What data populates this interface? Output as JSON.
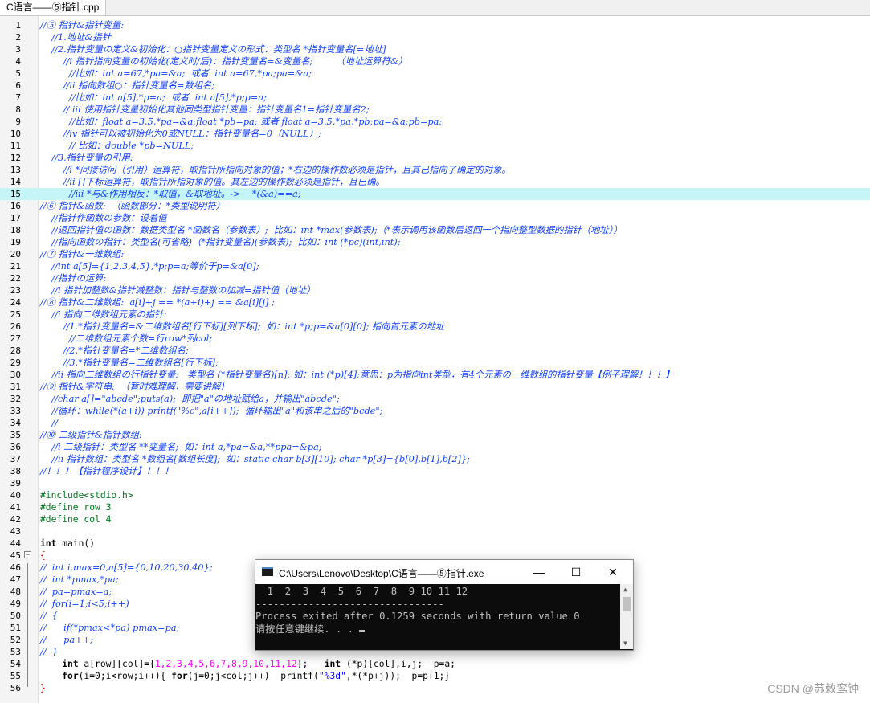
{
  "editor": {
    "tab_title": "C语言——⑤指针.cpp",
    "lines": [
      {
        "n": "1",
        "parts": [
          [
            "comment",
            "//⑤ 指针&指针变量:"
          ]
        ]
      },
      {
        "n": "2",
        "parts": [
          [
            "comment",
            "    //1.地址&指针"
          ]
        ]
      },
      {
        "n": "3",
        "parts": [
          [
            "comment",
            "    //2.指针变量の定义&初始化：○指针变量定义の形式：类型名 *指针变量名[=地址]"
          ]
        ]
      },
      {
        "n": "4",
        "parts": [
          [
            "comment",
            "        //ⅰ 指针指向变量の初始化(定义时/后)：指针变量名=&变量名;        （地址运算符&）"
          ]
        ]
      },
      {
        "n": "5",
        "parts": [
          [
            "comment",
            "          //比如：int a=67,*pa=&a;  或者  int a=67,*pa;pa=&a;"
          ]
        ]
      },
      {
        "n": "6",
        "parts": [
          [
            "comment",
            "        //ⅱ 指向数组○：指针变量名=数组名;"
          ]
        ]
      },
      {
        "n": "7",
        "parts": [
          [
            "comment",
            "          //比如：int a[5],*p=a;  或者  int a[5],*p;p=a;"
          ]
        ]
      },
      {
        "n": "8",
        "parts": [
          [
            "comment",
            "        // ⅲ 使用指针变量初始化其他同类型指针变量：指针变量名1=指针变量名2;"
          ]
        ]
      },
      {
        "n": "9",
        "parts": [
          [
            "comment",
            "          //比如：float a=3.5,*pa=&a;float *pb=pa; 或者 float a=3.5,*pa,*pb;pa=&a;pb=pa;"
          ]
        ]
      },
      {
        "n": "10",
        "parts": [
          [
            "comment",
            "        //ⅳ 指针可以被初始化为0或NULL：指针变量名=0（NULL）;"
          ]
        ]
      },
      {
        "n": "11",
        "parts": [
          [
            "comment",
            "          // 比如：double *pb=NULL;"
          ]
        ]
      },
      {
        "n": "12",
        "parts": [
          [
            "comment",
            "    //3.指针变量の引用:"
          ]
        ]
      },
      {
        "n": "13",
        "parts": [
          [
            "comment",
            "        //ⅰ *间接访问（引用）运算符，取指针所指向对象的值；*右边的操作数必须是指针，且其已指向了确定的对象。"
          ]
        ]
      },
      {
        "n": "14",
        "parts": [
          [
            "comment",
            "        //ⅱ []下标运算符，取指针所指对象的值。其左边的操作数必须是指针，且已确。"
          ]
        ]
      },
      {
        "n": "15",
        "hl": true,
        "parts": [
          [
            "comment",
            "          //ⅲ *与&作用相反：*取值，&取地址。->    *(&a)==a;"
          ]
        ]
      },
      {
        "n": "16",
        "parts": [
          [
            "comment",
            "//⑥ 指针&函数:  （函数部分：*类型说明符）"
          ]
        ]
      },
      {
        "n": "17",
        "parts": [
          [
            "comment",
            "    //指针作函数の参数：设着值"
          ]
        ]
      },
      {
        "n": "18",
        "parts": [
          [
            "comment",
            "    //返回指针值の函数：数据类型名 *函数名（参数表）;  比如：int *max(参数表);（*表示调用该函数后返回一个指向整型数据的指针（地址））"
          ]
        ]
      },
      {
        "n": "19",
        "parts": [
          [
            "comment",
            "    //指向函数の指针：类型名(可省略)（*指针变量名)(参数表);  比如：int (*pc)(int,int);"
          ]
        ]
      },
      {
        "n": "20",
        "parts": [
          [
            "comment",
            "//⑦ 指针&一维数组:"
          ]
        ]
      },
      {
        "n": "21",
        "parts": [
          [
            "comment",
            "    //int a[5]={1,2,3,4,5},*p;p=a;等价于p=&a[0];"
          ]
        ]
      },
      {
        "n": "22",
        "parts": [
          [
            "comment",
            "    //指针の运算:"
          ]
        ]
      },
      {
        "n": "23",
        "parts": [
          [
            "comment",
            "    //ⅰ 指针加整数&指针减整数：指针与整数の加减=指针值（地址）"
          ]
        ]
      },
      {
        "n": "24",
        "parts": [
          [
            "comment",
            "//⑧ 指针&二维数组:  a[i]+j == *(a+i)+j == &a[i][j] ;"
          ]
        ]
      },
      {
        "n": "25",
        "parts": [
          [
            "comment",
            "    //ⅰ 指向二维数组元素の指针:"
          ]
        ]
      },
      {
        "n": "26",
        "parts": [
          [
            "comment",
            "        //1.*指针变量名=&二维数组名[行下标][列下标];  如：int *p;p=&a[0][0]; 指向首元素の地址"
          ]
        ]
      },
      {
        "n": "27",
        "parts": [
          [
            "comment",
            "          //二维数组元素个数=行row*列col;"
          ]
        ]
      },
      {
        "n": "28",
        "parts": [
          [
            "comment",
            "        //2.*指针变量名=*二维数组名;"
          ]
        ]
      },
      {
        "n": "29",
        "parts": [
          [
            "comment",
            "        //3.*指针变量名=二维数组名[行下标];"
          ]
        ]
      },
      {
        "n": "30",
        "parts": [
          [
            "comment",
            "    //ⅱ 指向二维数组の行指针变量:   类型名 (*指针变量名)[n]; 如：int (*p)[4];意思：p为指向int类型，有4个元素の一维数组的指针变量【例子理解！！！】"
          ]
        ]
      },
      {
        "n": "31",
        "parts": [
          [
            "comment",
            "//⑨ 指针&字符串:  （暂时难理解，需要讲解）"
          ]
        ]
      },
      {
        "n": "32",
        "parts": [
          [
            "comment",
            "    //char a[]=\"abcde\";puts(a);  即把\"a\"の地址赋给a，并输出\"abcde\";"
          ]
        ]
      },
      {
        "n": "33",
        "parts": [
          [
            "comment",
            "    //循环：while(*(a+i)) printf(\"%c\",a[i++]);  循环输出\"a\"和该串之后的\"bcde\";"
          ]
        ]
      },
      {
        "n": "34",
        "parts": [
          [
            "comment",
            "    //"
          ]
        ]
      },
      {
        "n": "35",
        "parts": [
          [
            "comment",
            "//⑩ 二级指针&指针数组:"
          ]
        ]
      },
      {
        "n": "36",
        "parts": [
          [
            "comment",
            "    //ⅰ 二级指针：类型名 **变量名;  如：int a,*pa=&a,**ppa=&pa;"
          ]
        ]
      },
      {
        "n": "37",
        "parts": [
          [
            "comment",
            "    //ⅱ 指针数组：类型名 *数组名[数组长度];  如：static char b[3][10]; char *p[3]={b[0],b[1],b[2]};"
          ]
        ]
      },
      {
        "n": "38",
        "parts": [
          [
            "comment",
            "//！！！【指针程序设计】！！！"
          ]
        ]
      },
      {
        "n": "39",
        "parts": []
      },
      {
        "n": "40",
        "parts": [
          [
            "pre",
            "#include<stdio.h>"
          ]
        ]
      },
      {
        "n": "41",
        "parts": [
          [
            "pre",
            "#define row 3"
          ]
        ]
      },
      {
        "n": "42",
        "parts": [
          [
            "pre",
            "#define col 4"
          ]
        ]
      },
      {
        "n": "43",
        "parts": []
      },
      {
        "n": "44",
        "parts": [
          [
            "kw",
            "int"
          ],
          [
            "plain",
            " main()"
          ]
        ]
      },
      {
        "n": "45",
        "fold": true,
        "parts": [
          [
            "brace",
            "{"
          ]
        ]
      },
      {
        "n": "46",
        "parts": [
          [
            "comment",
            "//  int i,max=0,a[5]={0,10,20,30,40};"
          ]
        ]
      },
      {
        "n": "47",
        "parts": [
          [
            "comment",
            "//  int *pmax,*pa;"
          ]
        ]
      },
      {
        "n": "48",
        "parts": [
          [
            "comment",
            "//  pa=pmax=a;"
          ]
        ]
      },
      {
        "n": "49",
        "parts": [
          [
            "comment",
            "//  for(i=1;i<5;i++)"
          ]
        ]
      },
      {
        "n": "50",
        "parts": [
          [
            "comment",
            "//  {"
          ]
        ]
      },
      {
        "n": "51",
        "parts": [
          [
            "comment",
            "//      if(*pmax<*pa) pmax=pa;"
          ]
        ]
      },
      {
        "n": "52",
        "parts": [
          [
            "comment",
            "//      pa++;"
          ]
        ]
      },
      {
        "n": "53",
        "parts": [
          [
            "comment",
            "//  }"
          ]
        ]
      },
      {
        "n": "54",
        "parts": [
          [
            "plain",
            "    "
          ],
          [
            "kw",
            "int"
          ],
          [
            "plain",
            " a[row][col]={"
          ],
          [
            "num",
            "1,2,3,4,5,6,7,8,9,10,11,12"
          ],
          [
            "plain",
            "};   "
          ],
          [
            "kw",
            "int"
          ],
          [
            "plain",
            " (*p)[col],i,j;  p=a;"
          ]
        ]
      },
      {
        "n": "55",
        "parts": [
          [
            "plain",
            "    "
          ],
          [
            "kw",
            "for"
          ],
          [
            "plain",
            "(i=0;i<row;i++){ "
          ],
          [
            "kw",
            "for"
          ],
          [
            "plain",
            "(j=0;j<col;j++)  printf("
          ],
          [
            "str",
            "\"%3d\""
          ],
          [
            "plain",
            ",*(*p+j));  p=p+1;}"
          ]
        ]
      },
      {
        "n": "56",
        "parts": [
          [
            "brace",
            "}"
          ]
        ]
      }
    ]
  },
  "console": {
    "title": "C:\\Users\\Lenovo\\Desktop\\C语言——⑤指针.exe",
    "minimize": "—",
    "maximize": "☐",
    "close": "✕",
    "output_line1": "  1  2  3  4  5  6  7  8  9 10 11 12",
    "output_line2": "--------------------------------",
    "output_line3": "Process exited after 0.1259 seconds with return value 0",
    "output_line4": "请按任意键继续. . . "
  },
  "watermark": "CSDN @苏敕鸾钟"
}
